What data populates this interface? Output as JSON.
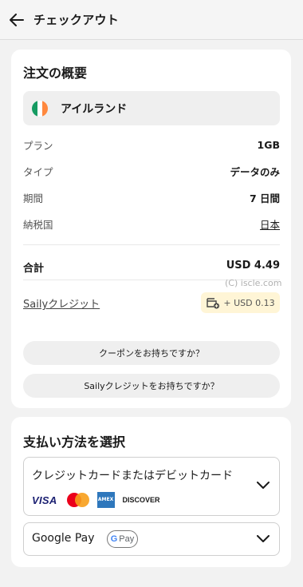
{
  "header": {
    "title": "チェックアウト"
  },
  "summary": {
    "title": "注文の概要",
    "country": "アイルランド",
    "flag_colors": [
      "#169b62",
      "#ffffff",
      "#ff883e"
    ],
    "rows": [
      {
        "label": "プラン",
        "value": "1GB"
      },
      {
        "label": "タイプ",
        "value": "データのみ"
      },
      {
        "label": "期間",
        "value": "7 日間"
      },
      {
        "label": "納税国",
        "value": "日本"
      }
    ],
    "total_label": "合計",
    "total_value": "USD 4.49",
    "watermark": "(C) iscle.com",
    "credit_label": "Sailyクレジット",
    "credit_value": "+ USD 0.13",
    "coupon_button": "クーポンをお持ちですか？",
    "credit_button": "Sailyクレジットをお持ちですか？"
  },
  "payment": {
    "title": "支払い方法を選択",
    "card_option": "クレジットカードまたはデビットカード",
    "card_logos": [
      "VISA",
      "AMEX",
      "DISCOVER"
    ],
    "gpay_option": "Google Pay",
    "gpay_badge_g": "G",
    "gpay_badge_pay": "Pay"
  },
  "colors": {
    "accent_yellow": "#fff5d6",
    "background": "#f2f2f2"
  }
}
